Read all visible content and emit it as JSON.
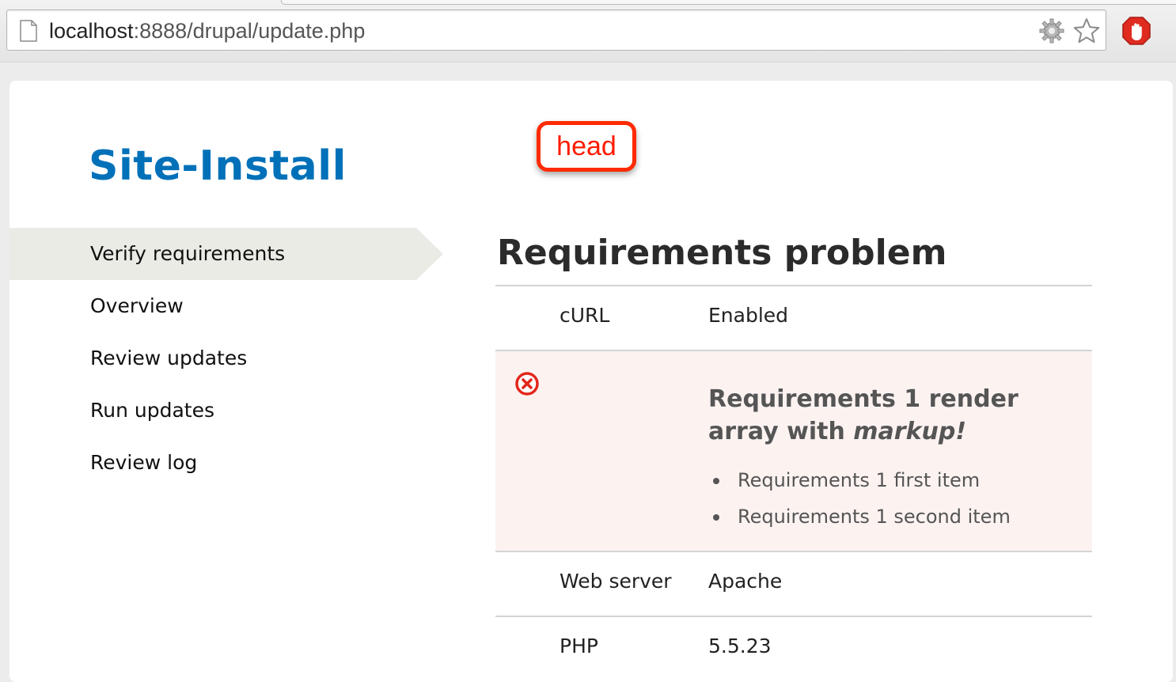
{
  "browser": {
    "url_host": "localhost",
    "url_path": ":8888/drupal/update.php",
    "icons": [
      "page-icon",
      "gear-icon",
      "star-icon",
      "adblock-icon"
    ]
  },
  "site": {
    "title": "Site-Install",
    "brand_color": "#0071b9"
  },
  "annotation": {
    "label": "head",
    "color": "#ff2a00"
  },
  "steps": {
    "items": [
      {
        "label": "Verify requirements",
        "active": true
      },
      {
        "label": "Overview"
      },
      {
        "label": "Review updates"
      },
      {
        "label": "Run updates"
      },
      {
        "label": "Review log"
      }
    ]
  },
  "main": {
    "title": "Requirements problem",
    "rows": [
      {
        "label": "cURL",
        "value": "Enabled"
      },
      {
        "status": "error",
        "icon": "error-icon",
        "title_prefix": "Requirements 1 render array with ",
        "title_emphasis": "markup!",
        "items": [
          "Requirements 1 first item",
          "Requirements 1 second item"
        ]
      },
      {
        "label": "Web server",
        "value": "Apache"
      },
      {
        "label": "PHP",
        "value": "5.5.23"
      }
    ],
    "error_color": "#e3261b",
    "error_background": "#fcf3f1"
  }
}
